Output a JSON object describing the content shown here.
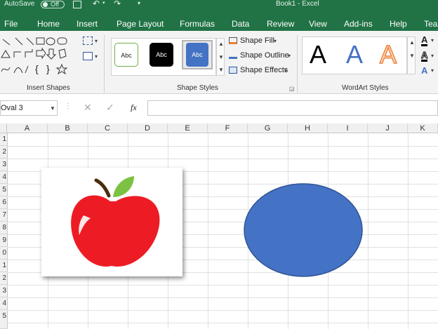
{
  "titlebar": {
    "autosave_label": "AutoSave",
    "autosave_state": "Off",
    "title": "Book1 - Excel"
  },
  "menu": {
    "items": [
      "File",
      "Home",
      "Insert",
      "Page Layout",
      "Formulas",
      "Data",
      "Review",
      "View",
      "Add-ins",
      "Help",
      "Tea"
    ]
  },
  "ribbon": {
    "insert_shapes_label": "Insert Shapes",
    "shape_styles_label": "Shape Styles",
    "wordart_styles_label": "WordArt Styles",
    "style_samples": [
      "Abc",
      "Abc",
      "Abc"
    ],
    "shape_fill_label": "Shape Fill",
    "shape_outline_label": "Shape Outline",
    "shape_effects_label": "Shape Effects",
    "wordart_letter": "A",
    "brace_left": "{",
    "brace_right": "}",
    "font_color_letter": "A"
  },
  "formula_bar": {
    "name_box": "Oval 3",
    "fx": "fx",
    "value": ""
  },
  "grid": {
    "columns": [
      "A",
      "B",
      "C",
      "D",
      "E",
      "F",
      "G",
      "H",
      "I",
      "J",
      "K"
    ],
    "rows": [
      "1",
      "2",
      "3",
      "4",
      "5",
      "6",
      "7",
      "8",
      "9",
      "0",
      "1",
      "2",
      "3",
      "4",
      "5"
    ]
  },
  "colors": {
    "excel_green": "#217346",
    "oval_fill": "#4472c4",
    "apple_red": "#ed1c24",
    "leaf_green": "#7cc242"
  }
}
